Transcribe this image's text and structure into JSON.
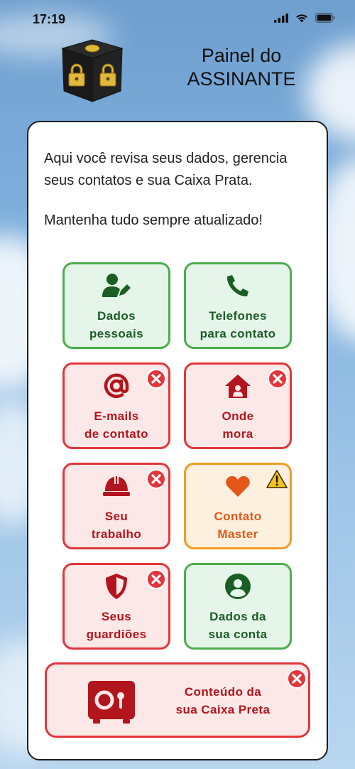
{
  "status_bar": {
    "time": "17:19"
  },
  "header": {
    "title_line1": "Painel do",
    "title_line2": "ASSINANTE"
  },
  "intro": {
    "paragraph1": "Aqui você revisa seus dados, gerencia seus contatos e sua Caixa Prata.",
    "paragraph2": "Mantenha tudo sempre atualizado!"
  },
  "tiles": [
    {
      "line1": "Dados",
      "line2": "pessoais",
      "status": "ok",
      "icon": "user-edit-icon"
    },
    {
      "line1": "Telefones",
      "line2": "para contato",
      "status": "ok",
      "icon": "phone-icon"
    },
    {
      "line1": "E-mails",
      "line2": "de contato",
      "status": "error",
      "icon": "at-icon"
    },
    {
      "line1": "Onde",
      "line2": "mora",
      "status": "error",
      "icon": "house-icon"
    },
    {
      "line1": "Seu",
      "line2": "trabalho",
      "status": "error",
      "icon": "hard-hat-icon"
    },
    {
      "line1": "Contato",
      "line2": "Master",
      "status": "warning",
      "icon": "heart-icon"
    },
    {
      "line1": "Seus",
      "line2": "guardiões",
      "status": "error",
      "icon": "shield-icon"
    },
    {
      "line1": "Dados da",
      "line2": "sua conta",
      "status": "ok",
      "icon": "user-circle-icon"
    }
  ],
  "vault": {
    "line1": "Conteúdo da",
    "line2": "sua Caixa Preta",
    "status": "error",
    "icon": "safe-icon"
  },
  "colors": {
    "ok": "#4cae4f",
    "error": "#e2363b",
    "warning": "#f39a22"
  }
}
